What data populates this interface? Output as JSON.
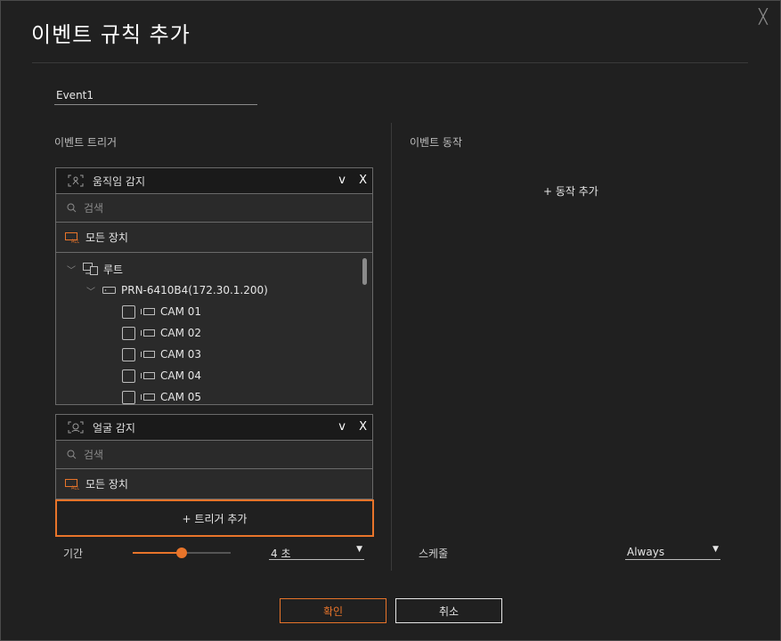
{
  "dialog": {
    "title": "이벤트 규칙 추가",
    "close_glyph": "╳"
  },
  "event_name": {
    "value": "Event1"
  },
  "trigger_section": {
    "label": "이벤트 트리거",
    "cards": [
      {
        "label": "움직임 감지",
        "icon": "motion-detection-icon",
        "chevron": "v",
        "remove": "X",
        "search_placeholder": "검색",
        "all_devices_label": "모든 장치",
        "tree": {
          "root_label": "루트",
          "device_label": "PRN-6410B4(172.30.1.200)",
          "cameras": [
            "CAM 01",
            "CAM 02",
            "CAM 03",
            "CAM 04",
            "CAM 05"
          ]
        }
      },
      {
        "label": "얼굴 감지",
        "icon": "face-detection-icon",
        "chevron": "v",
        "remove": "X",
        "search_placeholder": "검색",
        "all_devices_label": "모든 장치"
      }
    ],
    "add_trigger_label": "+ 트리거 추가",
    "duration_label": "기간",
    "duration_value": "4 초",
    "duration_slider_fraction": 0.5
  },
  "action_section": {
    "label": "이벤트 동작",
    "add_action_label": "+ 동작 추가",
    "schedule_label": "스케줄",
    "schedule_value": "Always"
  },
  "footer": {
    "ok_label": "확인",
    "cancel_label": "취소"
  },
  "colors": {
    "accent": "#e8742a",
    "background": "#202020",
    "header_bg": "#1a1a1a",
    "card_bg": "#2a2a2a"
  }
}
